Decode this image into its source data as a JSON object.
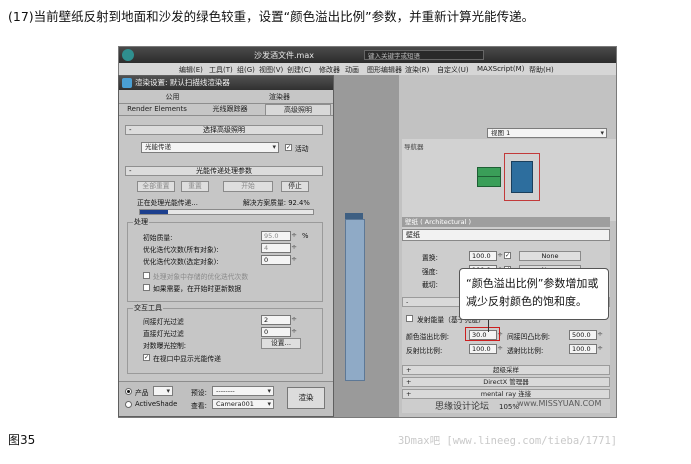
{
  "caption": "(17)当前壁纸反射到地面和沙发的绿色较重，设置“颜色溢出比例”参数，并重新计算光能传递。",
  "figure_label": "图35",
  "credit": "3Dmax吧 [www.lineeg.com/tieba/1771]",
  "app": {
    "title": "沙发酒文件.max",
    "search_placeholder": "键入关键字或短语",
    "menu": [
      "编辑(E)",
      "工具(T)",
      "组(G)",
      "视图(V)",
      "创建(C)",
      "修改器",
      "动画",
      "图形编辑器",
      "渲染(R)",
      "自定义(U)",
      "MAXScript(M)",
      "帮助(H)"
    ],
    "selection_dropdown": "选择",
    "view_dropdown": "视图 1",
    "nav_title": "导航器",
    "material_header": "壁纸 ( Architectural )",
    "material_name": "壁纸",
    "params": {
      "replace_label": "置换:",
      "replace_value": "100.0",
      "intensity_label": "强度:",
      "intensity_value": "100.0",
      "cutout_label": "截切:",
      "none1": "None",
      "none2": "None",
      "emit_label": "发射能量（基于亮度）",
      "color_bleed_label": "颜色溢出比例:",
      "color_bleed_value": "30.0",
      "indirect_bump_label": "间接凹凸比例:",
      "indirect_bump_value": "500.0",
      "reflect_label": "反射比比例:",
      "reflect_value": "100.0",
      "transmit_label": "透射比比例:",
      "transmit_value": "100.0"
    },
    "rollouts": [
      "超级采样",
      "DirectX 管理器",
      "mental ray 连接"
    ],
    "watermark": "思缘设计论坛",
    "watermark_url": "www.MISSYUAN.COM",
    "zoom": "105%"
  },
  "callout": "“颜色溢出比例”参数增加或减少反射颜色的饱和度。",
  "dialog": {
    "title": "渲染设置: 默认扫描线渲染器",
    "tabs_row1": [
      "公用",
      "渲染器"
    ],
    "tabs_row2": [
      "Render Elements",
      "光线跟踪器",
      "高级照明"
    ],
    "section1": "选择高级照明",
    "lighting_type": "光能传递",
    "active_label": "活动",
    "section2": "光能传递处理参数",
    "btn_reset_all": "全部重置",
    "btn_reset": "重置",
    "btn_start": "开始",
    "btn_stop": "停止",
    "status": "正在处理光能传递...",
    "solution_quality": "解决方案质量: 92.4%",
    "progress": 0.16,
    "processing": "处理",
    "initial_quality_label": "初始质量:",
    "initial_quality_value": "95.0",
    "initial_quality_unit": "%",
    "refine_all_label": "优化迭代次数(所有对象):",
    "refine_all_value": "4",
    "refine_sel_label": "优化迭代次数(选定对象):",
    "refine_sel_value": "0",
    "store_refine": "处理对象中存储的优化迭代次数",
    "update_on_start": "如果需要，在开始时更新数据",
    "interactive_tools": "交互工具",
    "indirect_filter_label": "间接灯光过滤",
    "indirect_filter_value": "2",
    "direct_filter_label": "直接灯光过滤",
    "direct_filter_value": "0",
    "exposure_label": "对数曝光控制:",
    "settings_btn": "设置...",
    "display_in_viewport": "在视口中显示光能传递",
    "mode_product": "产品",
    "mode_activeshade": "ActiveShade",
    "preset_label": "预设:",
    "preset_value": "--------",
    "view_label": "查看:",
    "view_value": "Camera001",
    "render_btn": "渲染"
  }
}
